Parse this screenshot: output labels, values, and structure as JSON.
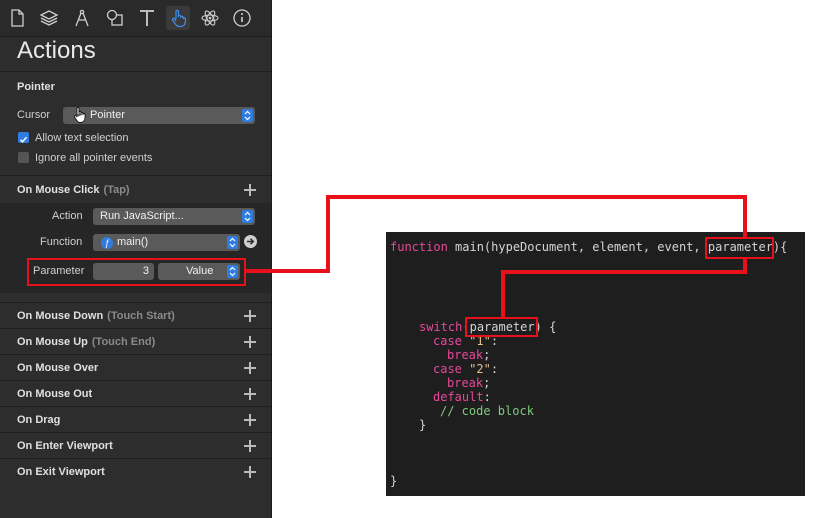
{
  "toolbar": {
    "icons": [
      "document-icon",
      "layers-icon",
      "compass-icon",
      "shapes-icon",
      "text-icon",
      "hand-pointer-icon",
      "atom-icon",
      "info-icon"
    ]
  },
  "panel": {
    "title": "Actions",
    "pointer": {
      "heading": "Pointer",
      "cursor_label": "Cursor",
      "cursor_value": "Pointer",
      "allow_text_selection": "Allow text selection",
      "ignore_pointer_events": "Ignore all pointer events"
    },
    "mouse_click": {
      "heading": "On Mouse Click",
      "sub": "(Tap)",
      "action_label": "Action",
      "action_value": "Run JavaScript...",
      "function_label": "Function",
      "function_value": "main()",
      "parameter_label": "Parameter",
      "parameter_value": "3",
      "parameter_type": "Value"
    },
    "events": [
      {
        "title": "On Mouse Down",
        "sub": "(Touch Start)"
      },
      {
        "title": "On Mouse Up",
        "sub": "(Touch End)"
      },
      {
        "title": "On Mouse Over",
        "sub": ""
      },
      {
        "title": "On Mouse Out",
        "sub": ""
      },
      {
        "title": "On Drag",
        "sub": ""
      },
      {
        "title": "On Enter Viewport",
        "sub": ""
      },
      {
        "title": "On Exit Viewport",
        "sub": ""
      }
    ]
  },
  "code": {
    "l1_kw": "function",
    "l1_rest": " main(hypeDocument, element, event, ",
    "l1_param": "parameter",
    "l1_end": "){",
    "l2_kw": "switch",
    "l2_open": "(",
    "l2_param": "parameter",
    "l2_end": ") {",
    "case_kw1": "case",
    "case_val1": "\"1\"",
    "colon": ":",
    "break1": "break",
    "semi": ";",
    "case_kw2": "case",
    "case_val2": "\"2\"",
    "break2": "break",
    "default_kw": "default",
    "comment": "// code block",
    "close_inner": "}",
    "close_outer": "}"
  },
  "colors": {
    "accent": "#2f7de0",
    "highlight": "#e8101b",
    "keyword": "#e8489a",
    "comment": "#7fc97f"
  }
}
